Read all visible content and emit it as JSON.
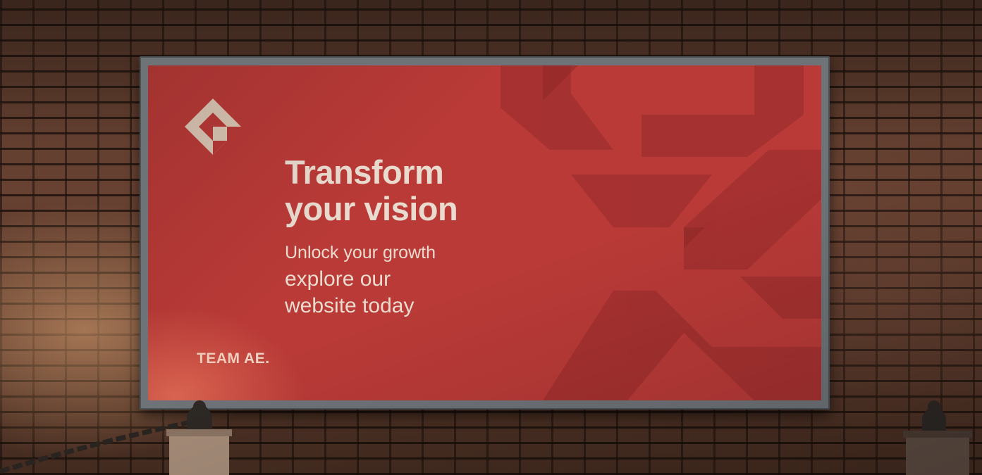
{
  "billboard": {
    "headline_line1": "Transform",
    "headline_line2": "your vision",
    "sub_line1": "Unlock your growth",
    "sub_line2": "explore our",
    "sub_line3": "website today",
    "brand": "TEAM AE."
  },
  "colors": {
    "billboard_red": "#b93a37",
    "text_cream": "#eadbcf",
    "frame_gray": "#6d7377",
    "brick": "#5a3a2c"
  },
  "icons": [
    "house-logo-icon",
    "abstract-arrow-graphic"
  ]
}
